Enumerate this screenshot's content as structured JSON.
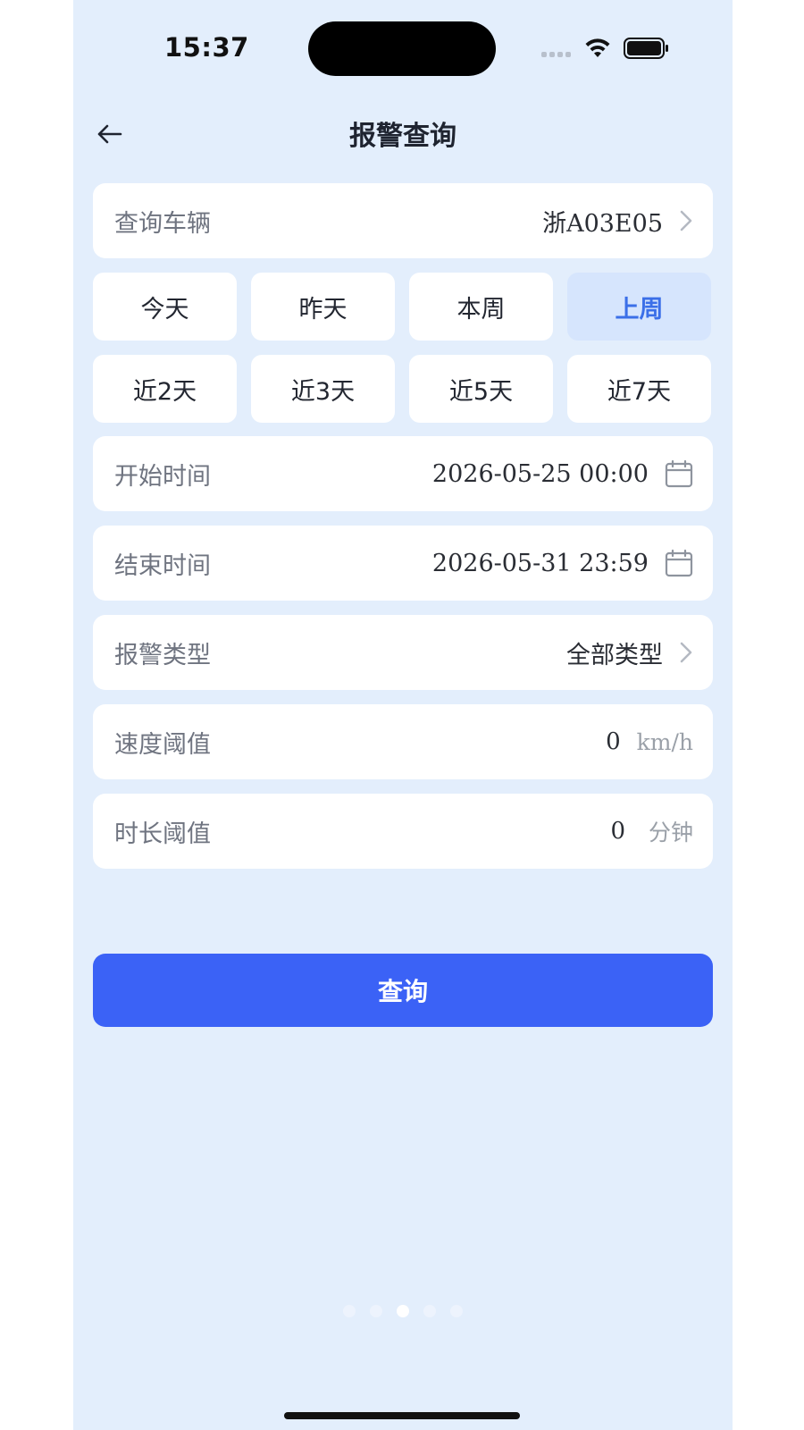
{
  "status_bar": {
    "time": "15:37"
  },
  "header": {
    "title": "报警查询"
  },
  "vehicle": {
    "label": "查询车辆",
    "value": "浙A03E05"
  },
  "quick_ranges": [
    {
      "label": "今天",
      "active": false
    },
    {
      "label": "昨天",
      "active": false
    },
    {
      "label": "本周",
      "active": false
    },
    {
      "label": "上周",
      "active": true
    },
    {
      "label": "近2天",
      "active": false
    },
    {
      "label": "近3天",
      "active": false
    },
    {
      "label": "近5天",
      "active": false
    },
    {
      "label": "近7天",
      "active": false
    }
  ],
  "start_time": {
    "label": "开始时间",
    "value": "2026-05-25 00:00"
  },
  "end_time": {
    "label": "结束时间",
    "value": "2026-05-31 23:59"
  },
  "alarm_type": {
    "label": "报警类型",
    "value": "全部类型"
  },
  "speed_threshold": {
    "label": "速度阈值",
    "value": "0",
    "unit": "km/h"
  },
  "duration_threshold": {
    "label": "时长阈值",
    "value": "0",
    "unit": "分钟"
  },
  "submit": {
    "label": "查询"
  },
  "pager": {
    "count": 5,
    "current": 3
  },
  "colors": {
    "background": "#e3eefc",
    "primary": "#3b62f6",
    "active_chip_bg": "#d6e5fd",
    "active_chip_text": "#3b6fe8"
  },
  "icons": {
    "back": "arrow-left-icon",
    "chevron": "chevron-right-icon",
    "calendar": "calendar-icon",
    "wifi": "wifi-icon",
    "battery": "battery-icon"
  }
}
